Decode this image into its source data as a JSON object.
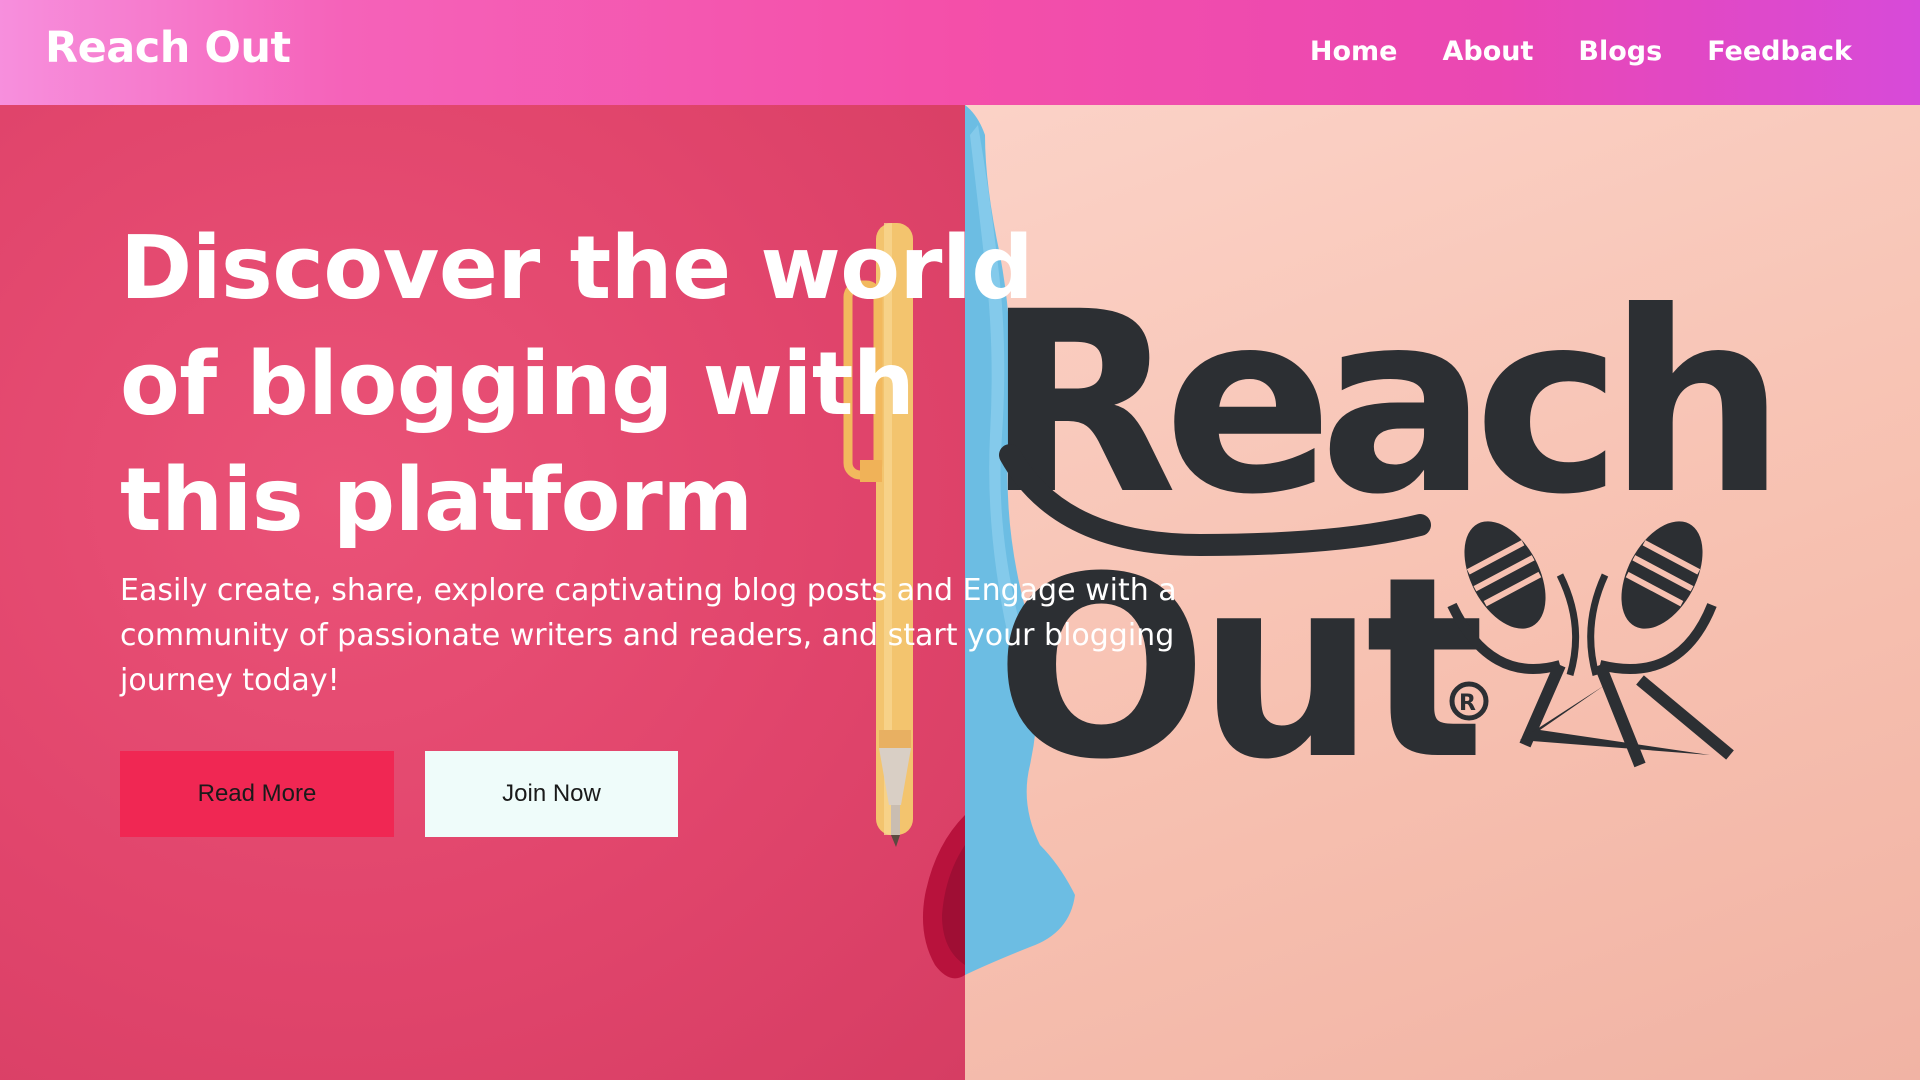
{
  "navbar": {
    "brand": "Reach Out",
    "links": [
      "Home",
      "About",
      "Blogs",
      "Feedback"
    ]
  },
  "hero": {
    "title": "Discover the world of blogging with this platform",
    "description": "Easily create, share, explore captivating blog posts and Engage with a community of passionate writers and readers, and start your blogging journey today!",
    "buttons": {
      "read_more": "Read More",
      "join_now": "Join Now"
    },
    "logo_image": {
      "text_line1": "Reach",
      "text_line2": "Out",
      "registered_mark": "®"
    }
  },
  "colors": {
    "nav_gradient_start": "#f78fdd",
    "nav_gradient_end": "#d74ad9",
    "hero_left": "#e1456c",
    "hero_right": "#f7c1b1",
    "read_more_button": "#f02753",
    "join_now_button": "#effcfa",
    "logo_ink": "#2c2f33"
  }
}
